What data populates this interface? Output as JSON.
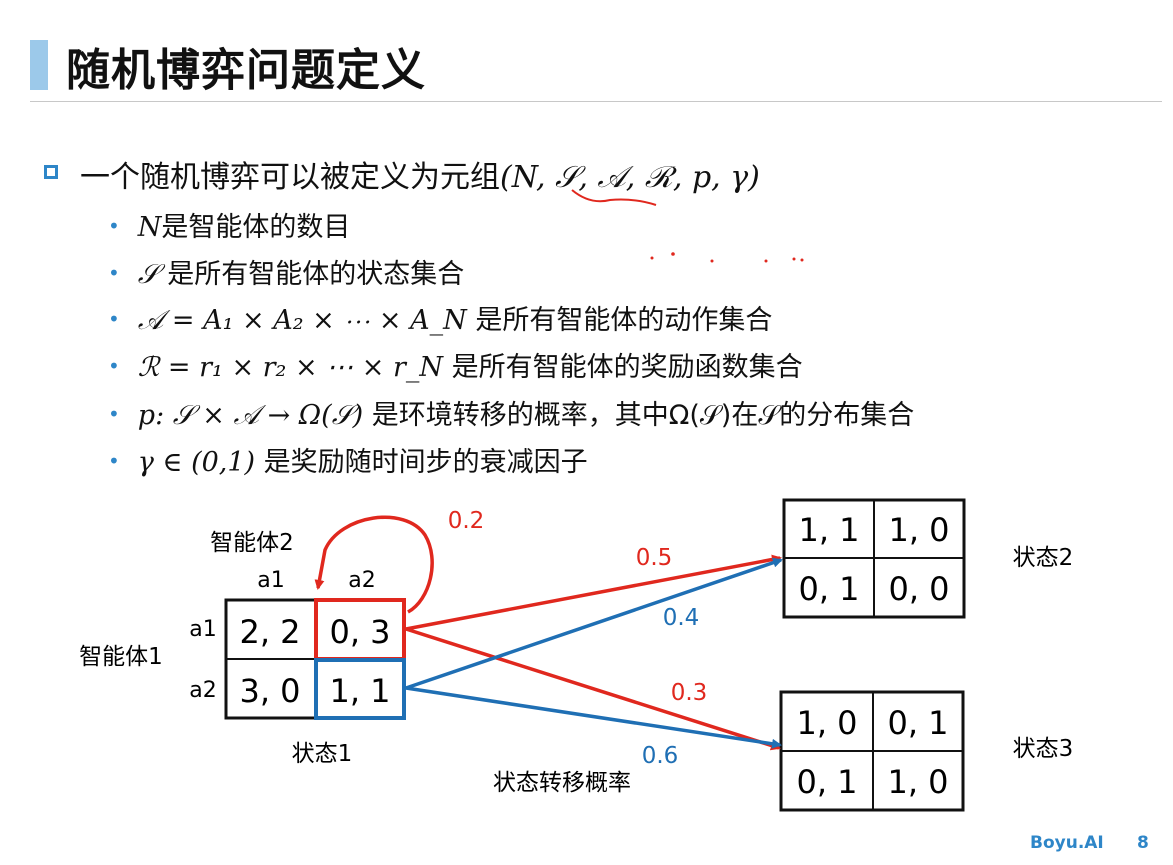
{
  "slide": {
    "title": "随机博弈问题定义",
    "main_text": "一个随机博弈可以被定义为元组",
    "tuple": "(N, 𝒮, 𝒜, ℛ, p, γ)",
    "bullets": [
      {
        "math": "N",
        "text": "是智能体的数目"
      },
      {
        "math": "𝒮",
        "text": " 是所有智能体的状态集合"
      },
      {
        "math": "𝒜 = A₁ × A₂ × ⋯ × A_N",
        "text": " 是所有智能体的动作集合"
      },
      {
        "math": "ℛ = r₁ × r₂ × ⋯ × r_N",
        "text": " 是所有智能体的奖励函数集合"
      },
      {
        "math": "p: 𝒮 × 𝒜 → Ω(𝒮)",
        "text": " 是环境转移的概率，其中Ω(𝒮)在𝒮的分布集合"
      },
      {
        "math": "γ ∈ (0,1)",
        "text": " 是奖励随时间步的衰减因子"
      }
    ]
  },
  "diagram": {
    "agent1_label": "智能体1",
    "agent2_label": "智能体2",
    "col_actions": [
      "a1",
      "a2"
    ],
    "row_actions": [
      "a1",
      "a2"
    ],
    "state1": {
      "label": "状态1",
      "cells": [
        "2, 2",
        "0, 3",
        "3, 0",
        "1, 1"
      ]
    },
    "state2": {
      "label": "状态2",
      "cells": [
        "1, 1",
        "1, 0",
        "0, 1",
        "0, 0"
      ]
    },
    "state3": {
      "label": "状态3",
      "cells": [
        "1, 0",
        "0, 1",
        "0, 1",
        "1, 0"
      ]
    },
    "probabilities": {
      "self_loop": "0.2",
      "red_to_state2": "0.5",
      "blue_to_state2": "0.4",
      "red_to_state3": "0.3",
      "blue_to_state3": "0.6"
    },
    "transition_label": "状态转移概率",
    "colors": {
      "red": "#e0281e",
      "blue": "#1f6fb4",
      "accent": "#2e86c8"
    }
  },
  "footer": {
    "brand": "Boyu.AI",
    "page": "8"
  }
}
